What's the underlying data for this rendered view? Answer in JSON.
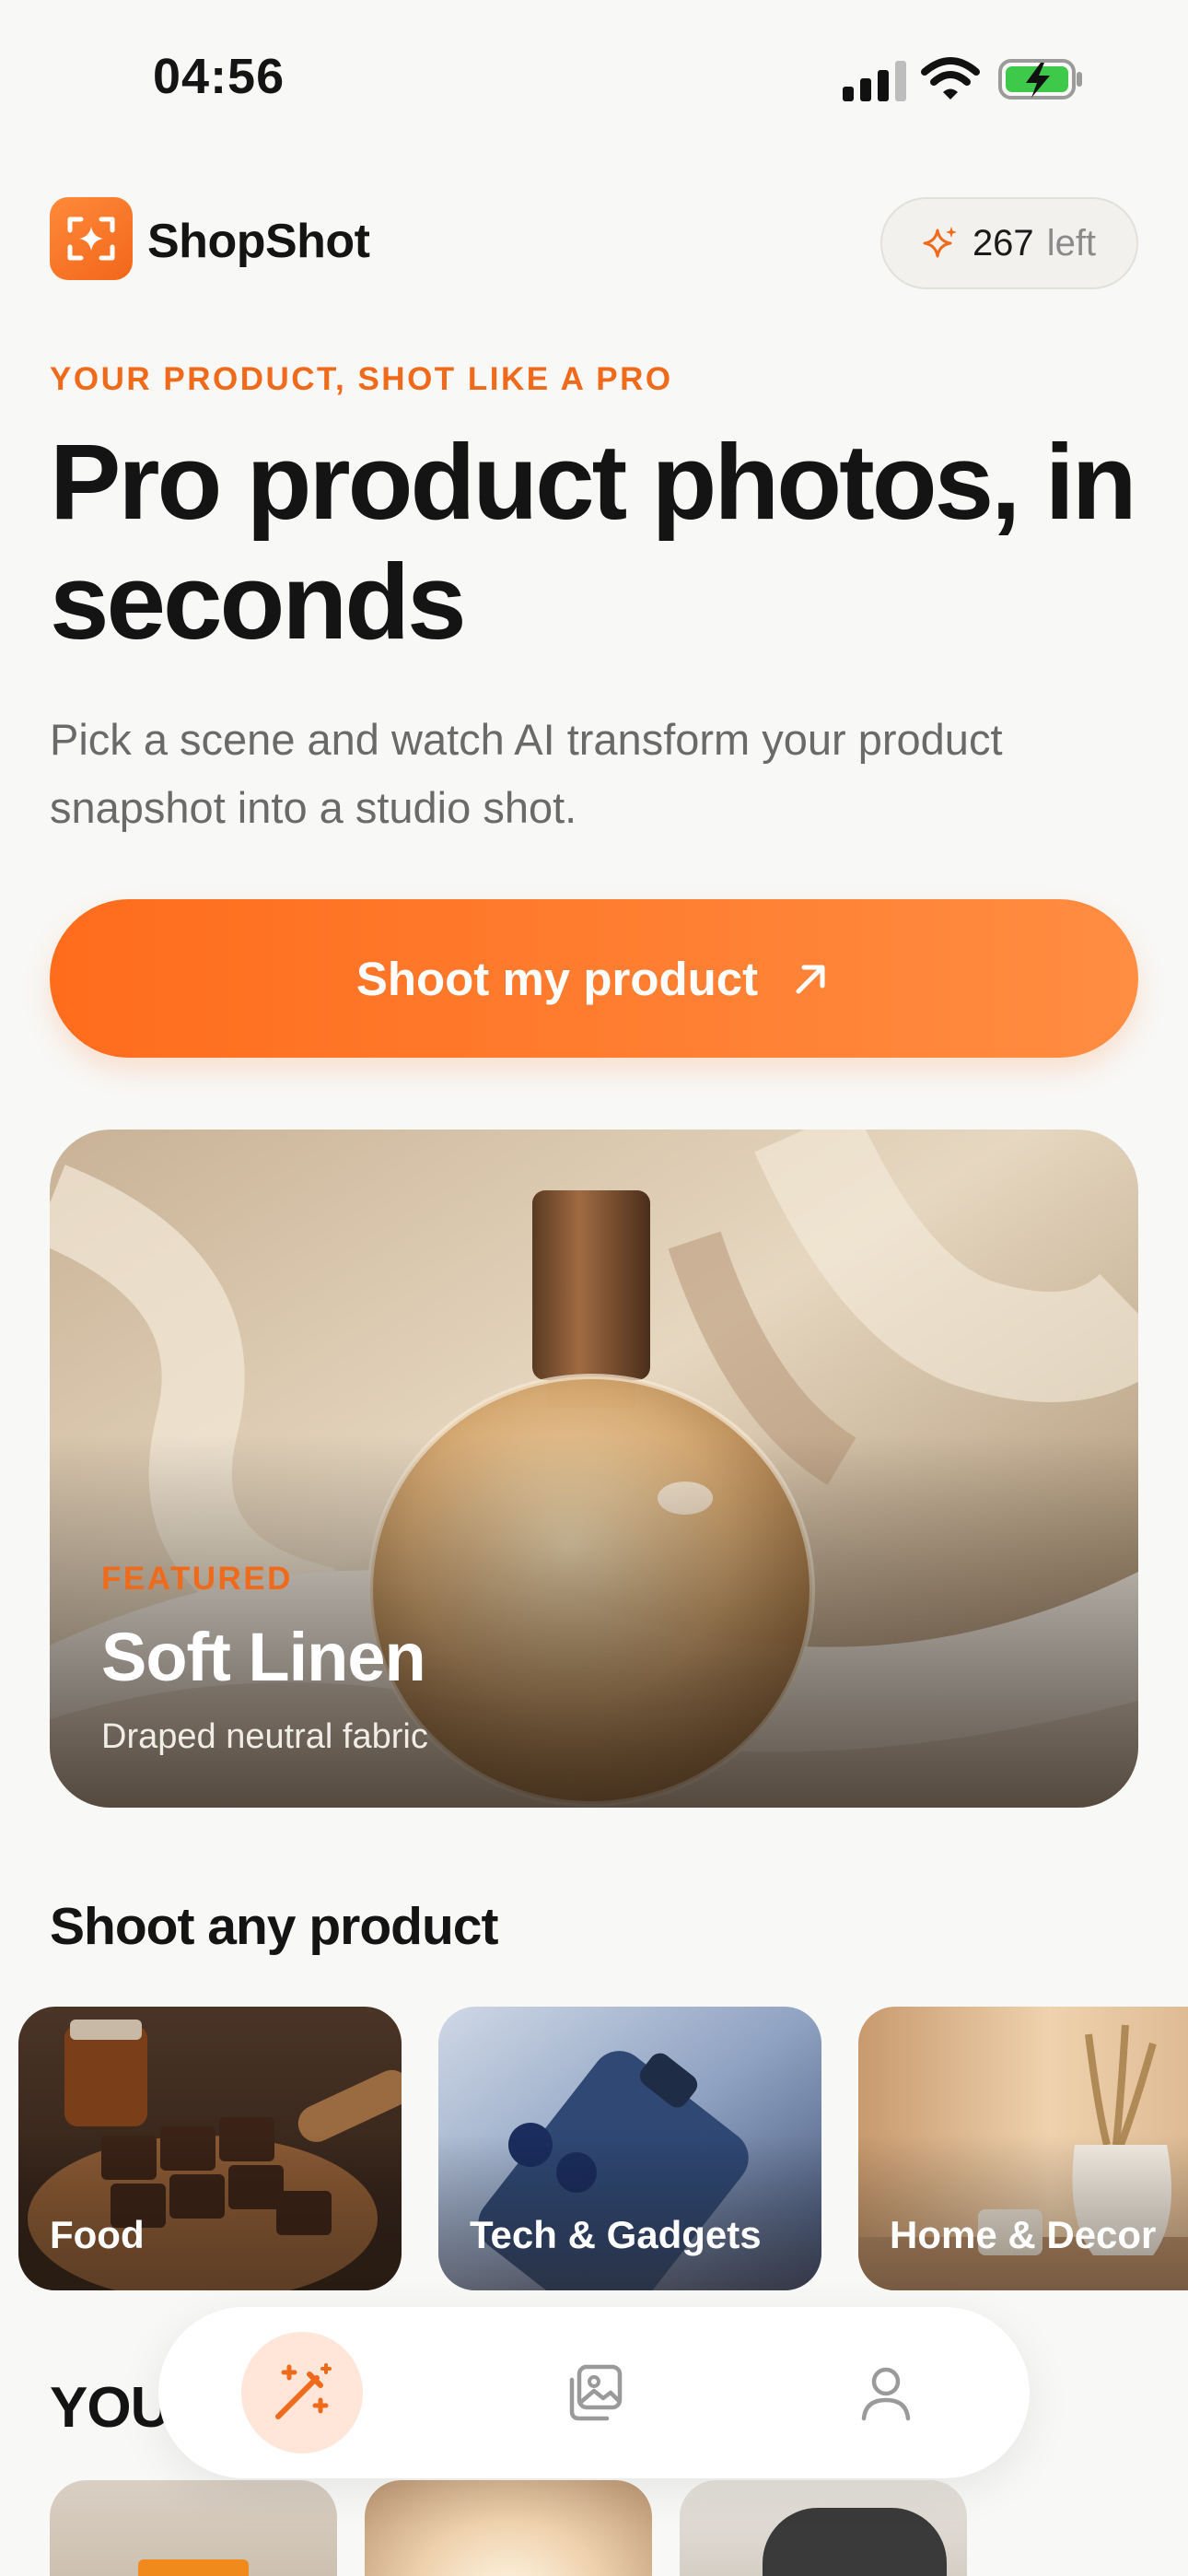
{
  "status_bar": {
    "time": "04:56"
  },
  "header": {
    "app_name": "ShopShot",
    "credits_count": "267",
    "credits_suffix": "left"
  },
  "hero": {
    "eyebrow": "YOUR PRODUCT, SHOT LIKE A PRO",
    "title": "Pro product photos, in seconds",
    "subtitle": "Pick a scene and watch AI transform your product snapshot into a studio shot.",
    "cta_label": "Shoot my product"
  },
  "featured": {
    "eyebrow": "FEATURED",
    "title": "Soft Linen",
    "subtitle": "Draped neutral fabric"
  },
  "categories_section": {
    "title": "Shoot any product",
    "items": [
      {
        "label": "Food"
      },
      {
        "label": "Tech & Gadgets"
      },
      {
        "label": "Home & Decor"
      }
    ]
  },
  "second_section": {
    "title": "YOU"
  },
  "nav": {
    "items": [
      {
        "icon": "magic-wand-icon",
        "active": true
      },
      {
        "icon": "gallery-icon",
        "active": false
      },
      {
        "icon": "profile-icon",
        "active": false
      }
    ]
  },
  "colors": {
    "accent": "#f06a1c",
    "cta_start": "#ff6c1c",
    "cta_end": "#ff8d42",
    "background": "#f8f8f6"
  }
}
